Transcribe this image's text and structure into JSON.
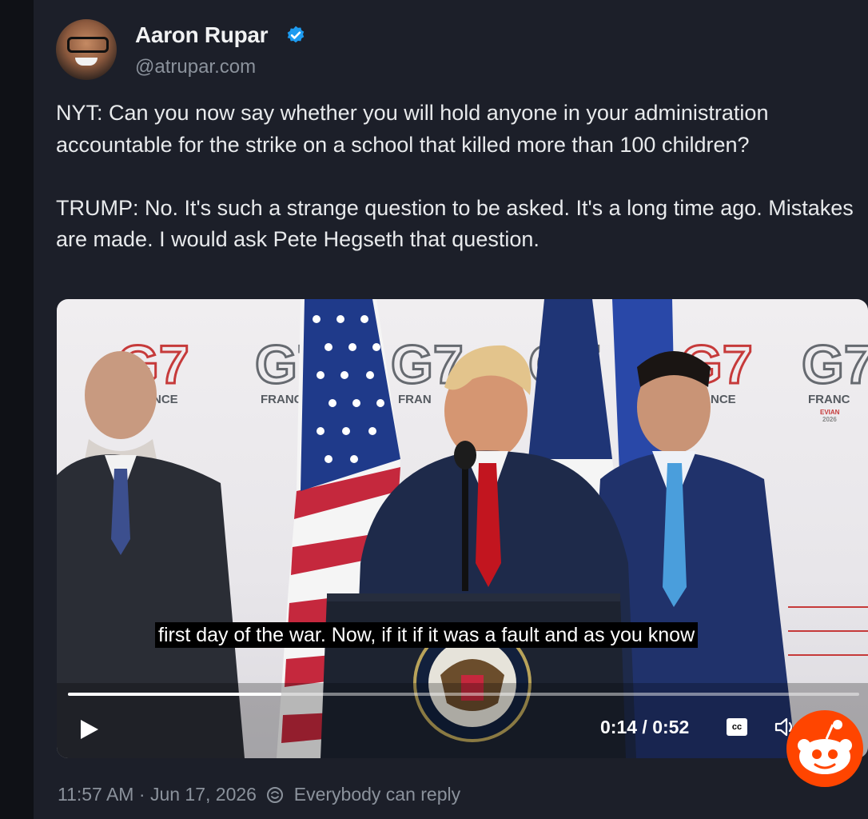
{
  "author": {
    "name": "Aaron Rupar",
    "handle": "@atrupar.com",
    "verified": true
  },
  "post": {
    "paragraphs": [
      "NYT: Can you now say whether you will hold anyone in your administration accountable for the strike on a school that killed more than 100 children?",
      "TRUMP: No. It's such a strange question to be asked. It's a long time ago. Mistakes are made. I would ask Pete Hegseth that question."
    ]
  },
  "video": {
    "backdrop_logos": [
      "G7",
      "G7",
      "G7",
      "G7",
      "G7",
      "G7"
    ],
    "backdrop_text": [
      "NCE",
      "FRANC",
      "FRAN",
      "NCE",
      "FRANC"
    ],
    "backdrop_subtext": [
      "EVIAN",
      "2026"
    ],
    "caption": "first day of the war. Now, if it if it was a fault and as you know",
    "progress_fraction": 0.27,
    "time_display": "0:14 / 0:52",
    "cc_label": "cc"
  },
  "meta": {
    "time": "11:57 AM",
    "separator": "·",
    "date": "Jun 17, 2026",
    "reply_setting": "Everybody can reply"
  },
  "colors": {
    "background": "#171a22",
    "card": "#1c1f29",
    "verified_blue": "#1d9bf0",
    "muted_text": "#8b929c",
    "reddit_orange": "#ff4500"
  }
}
